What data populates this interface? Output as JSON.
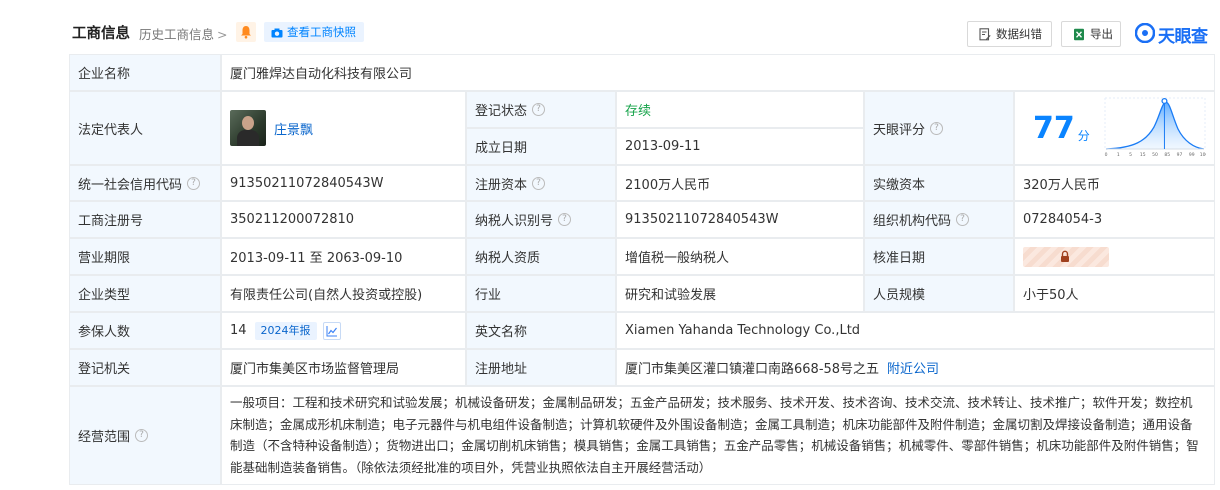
{
  "header": {
    "title": "工商信息",
    "history_link": "历史工商信息",
    "history_chevron": ">",
    "snapshot_button": "查看工商快照",
    "correct_button": "数据纠错",
    "export_button": "导出",
    "logo_text": "天眼查"
  },
  "labels": {
    "company_name": "企业名称",
    "legal_rep": "法定代表人",
    "reg_status": "登记状态",
    "established": "成立日期",
    "tianyan_score": "天眼评分",
    "credit_code": "统一社会信用代码",
    "reg_capital": "注册资本",
    "paid_capital": "实缴资本",
    "reg_number": "工商注册号",
    "taxpayer_id": "纳税人识别号",
    "org_code": "组织机构代码",
    "business_term": "营业期限",
    "taxpayer_qual": "纳税人资质",
    "approval_date": "核准日期",
    "company_type": "企业类型",
    "industry": "行业",
    "staff_size": "人员规模",
    "insured": "参保人数",
    "english_name": "英文名称",
    "reg_authority": "登记机关",
    "reg_address": "注册地址",
    "business_scope": "经营范围"
  },
  "values": {
    "company_name": "厦门雅焊达自动化科技有限公司",
    "legal_rep": "庄景飘",
    "reg_status": "存续",
    "established": "2013-09-11",
    "score": "77",
    "score_unit": "分",
    "credit_code": "91350211072840543W",
    "reg_capital": "2100万人民币",
    "paid_capital": "320万人民币",
    "reg_number": "350211200072810",
    "taxpayer_id": "91350211072840543W",
    "org_code": "07284054-3",
    "business_term": "2013-09-11 至 2063-09-10",
    "taxpayer_qual": "增值税一般纳税人",
    "company_type": "有限责任公司(自然人投资或控股)",
    "industry": "研究和试验发展",
    "staff_size": "小于50人",
    "insured": "14",
    "report_badge": "2024年报",
    "english_name": "Xiamen Yahanda Technology Co.,Ltd",
    "reg_authority": "厦门市集美区市场监督管理局",
    "reg_address": "厦门市集美区灌口镇灌口南路668-58号之五",
    "nearby_link": "附近公司",
    "business_scope": "一般项目：工程和技术研究和试验发展；机械设备研发；金属制品研发；五金产品研发；技术服务、技术开发、技术咨询、技术交流、技术转让、技术推广；软件开发；数控机床制造；金属成形机床制造；电子元器件与机电组件设备制造；计算机软硬件及外围设备制造；金属工具制造；机床功能部件及附件制造；金属切割及焊接设备制造；通用设备制造（不含特种设备制造）；货物进出口；金属切削机床销售；模具销售；金属工具销售；五金产品零售；机械设备销售；机械零件、零部件销售；机床功能部件及附件销售；智能基础制造装备销售。（除依法须经批准的项目外，凭营业执照依法自主开展经营活动）"
  },
  "score_chart": {
    "ticks": [
      "0",
      "1",
      "5",
      "15",
      "50",
      "85",
      "97",
      "99",
      "100"
    ],
    "marker_value": 77
  },
  "colors": {
    "label_bg": "#f2f8fe",
    "border": "#e9ecef",
    "link": "#0a66cc",
    "accent": "#0a84ff",
    "status_green": "#16a34a"
  },
  "icons": {
    "bell": "bell-icon",
    "camera": "camera-icon",
    "correct": "document-edit-icon",
    "export": "excel-export-icon",
    "help": "question-circle-icon",
    "lock": "lock-icon",
    "trend": "trend-chart-icon"
  }
}
